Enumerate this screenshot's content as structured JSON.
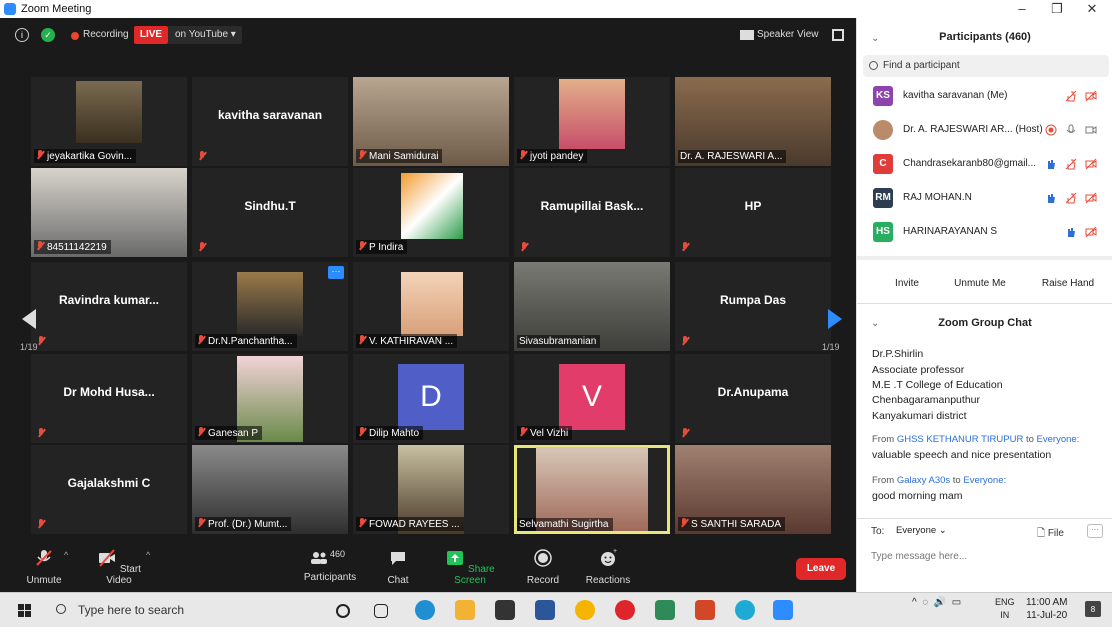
{
  "window": {
    "title": "Zoom Meeting"
  },
  "topbar": {
    "recording_label": "Recording",
    "live_label": "LIVE",
    "youtube_label": "on YouTube ▾",
    "speaker_view_label": "Speaker View"
  },
  "tiles": [
    {
      "name": "jeyakartika Govin...",
      "video": true,
      "muted": true
    },
    {
      "name": "kavitha saravanan",
      "video": false,
      "muted": true
    },
    {
      "name": "Mani Samidurai",
      "video": true,
      "muted": true
    },
    {
      "name": "jyoti pandey",
      "video": true,
      "muted": true
    },
    {
      "name": "Dr. A. RAJESWARI A...",
      "video": true,
      "muted": false
    },
    {
      "name": "84511142219",
      "video": true,
      "muted": true
    },
    {
      "name": "Sindhu.T",
      "video": false,
      "muted": true
    },
    {
      "name": "P Indira",
      "video": true,
      "muted": true
    },
    {
      "name": "Ramupillai Bask...",
      "video": false,
      "muted": true
    },
    {
      "name": "HP",
      "video": false,
      "muted": true
    },
    {
      "name": "Ravindra kumar...",
      "video": false,
      "muted": true
    },
    {
      "name": "Dr.N.Panchantha...",
      "video": true,
      "muted": true
    },
    {
      "name": "V. KATHIRAVAN ...",
      "video": true,
      "muted": true
    },
    {
      "name": "Sivasubramanian",
      "video": true,
      "muted": false
    },
    {
      "name": "Rumpa Das",
      "video": false,
      "muted": true
    },
    {
      "name": "Dr Mohd Husa...",
      "video": false,
      "muted": true
    },
    {
      "name": "Ganesan P",
      "video": true,
      "muted": true
    },
    {
      "name": "Dilip Mahto",
      "video": false,
      "muted": true,
      "avatar": "D",
      "avatar_color": "#4f5fc7"
    },
    {
      "name": "Vel Vizhi",
      "video": false,
      "muted": true,
      "avatar": "V",
      "avatar_color": "#e23c6b"
    },
    {
      "name": "Dr.Anupama",
      "video": false,
      "muted": true
    },
    {
      "name": "Gajalakshmi C",
      "video": false,
      "muted": true
    },
    {
      "name": "Prof. (Dr.) Mumt...",
      "video": true,
      "muted": true
    },
    {
      "name": "FOWAD RAYEES ...",
      "video": true,
      "muted": true
    },
    {
      "name": "Selvamathi Sugirtha",
      "video": true,
      "muted": false,
      "active": true
    },
    {
      "name": "S SANTHI SARADA",
      "video": true,
      "muted": true
    }
  ],
  "pagination": {
    "left": "1/19",
    "right": "1/19"
  },
  "toolbar": {
    "unmute": "Unmute",
    "start_video": "Start Video",
    "participants": "Participants",
    "participant_count": "460",
    "chat": "Chat",
    "share_screen": "Share Screen",
    "record": "Record",
    "reactions": "Reactions",
    "leave": "Leave"
  },
  "participants_panel": {
    "title": "Participants (460)",
    "search_placeholder": "Find a participant",
    "rows": [
      {
        "initials": "KS",
        "color": "#8e44ad",
        "name": "kavitha saravanan (Me)"
      },
      {
        "initials": "",
        "color": "#b98b6a",
        "name": "Dr. A. RAJESWARI AR... (Host)"
      },
      {
        "initials": "C",
        "color": "#e03c3c",
        "name": "Chandrasekaranb80@gmail..."
      },
      {
        "initials": "RM",
        "color": "#2c3e50",
        "name": "RAJ MOHAN.N"
      },
      {
        "initials": "HS",
        "color": "#27ae60",
        "name": "HARINARAYANAN S"
      }
    ],
    "invite": "Invite",
    "unmute_me": "Unmute Me",
    "raise_hand": "Raise Hand"
  },
  "chat_panel": {
    "title": "Zoom Group Chat",
    "lines": [
      "Dr.P.Shirlin",
      "Associate professor",
      "M.E .T College of Education",
      "Chenbagaramanputhur",
      "Kanyakumari district"
    ],
    "messages": [
      {
        "from_prefix": "From ",
        "sender": "GHSS KETHANUR TIRUPUR",
        "to_word": " to ",
        "recipient": "Everyone:",
        "text": "valuable speech and nice presentation"
      },
      {
        "from_prefix": "From ",
        "sender": "Galaxy A30s",
        "to_word": " to ",
        "recipient": "Everyone:",
        "text": "good morning mam"
      }
    ],
    "to_label": "To:",
    "everyone_label": "Everyone ⌄",
    "file_label": "File",
    "input_placeholder": "Type message here..."
  },
  "taskbar": {
    "search_placeholder": "Type here to search",
    "lang_top": "ENG",
    "lang_bottom": "IN",
    "time": "11:00 AM",
    "date": "11-Jul-20",
    "notification_count": "8"
  }
}
